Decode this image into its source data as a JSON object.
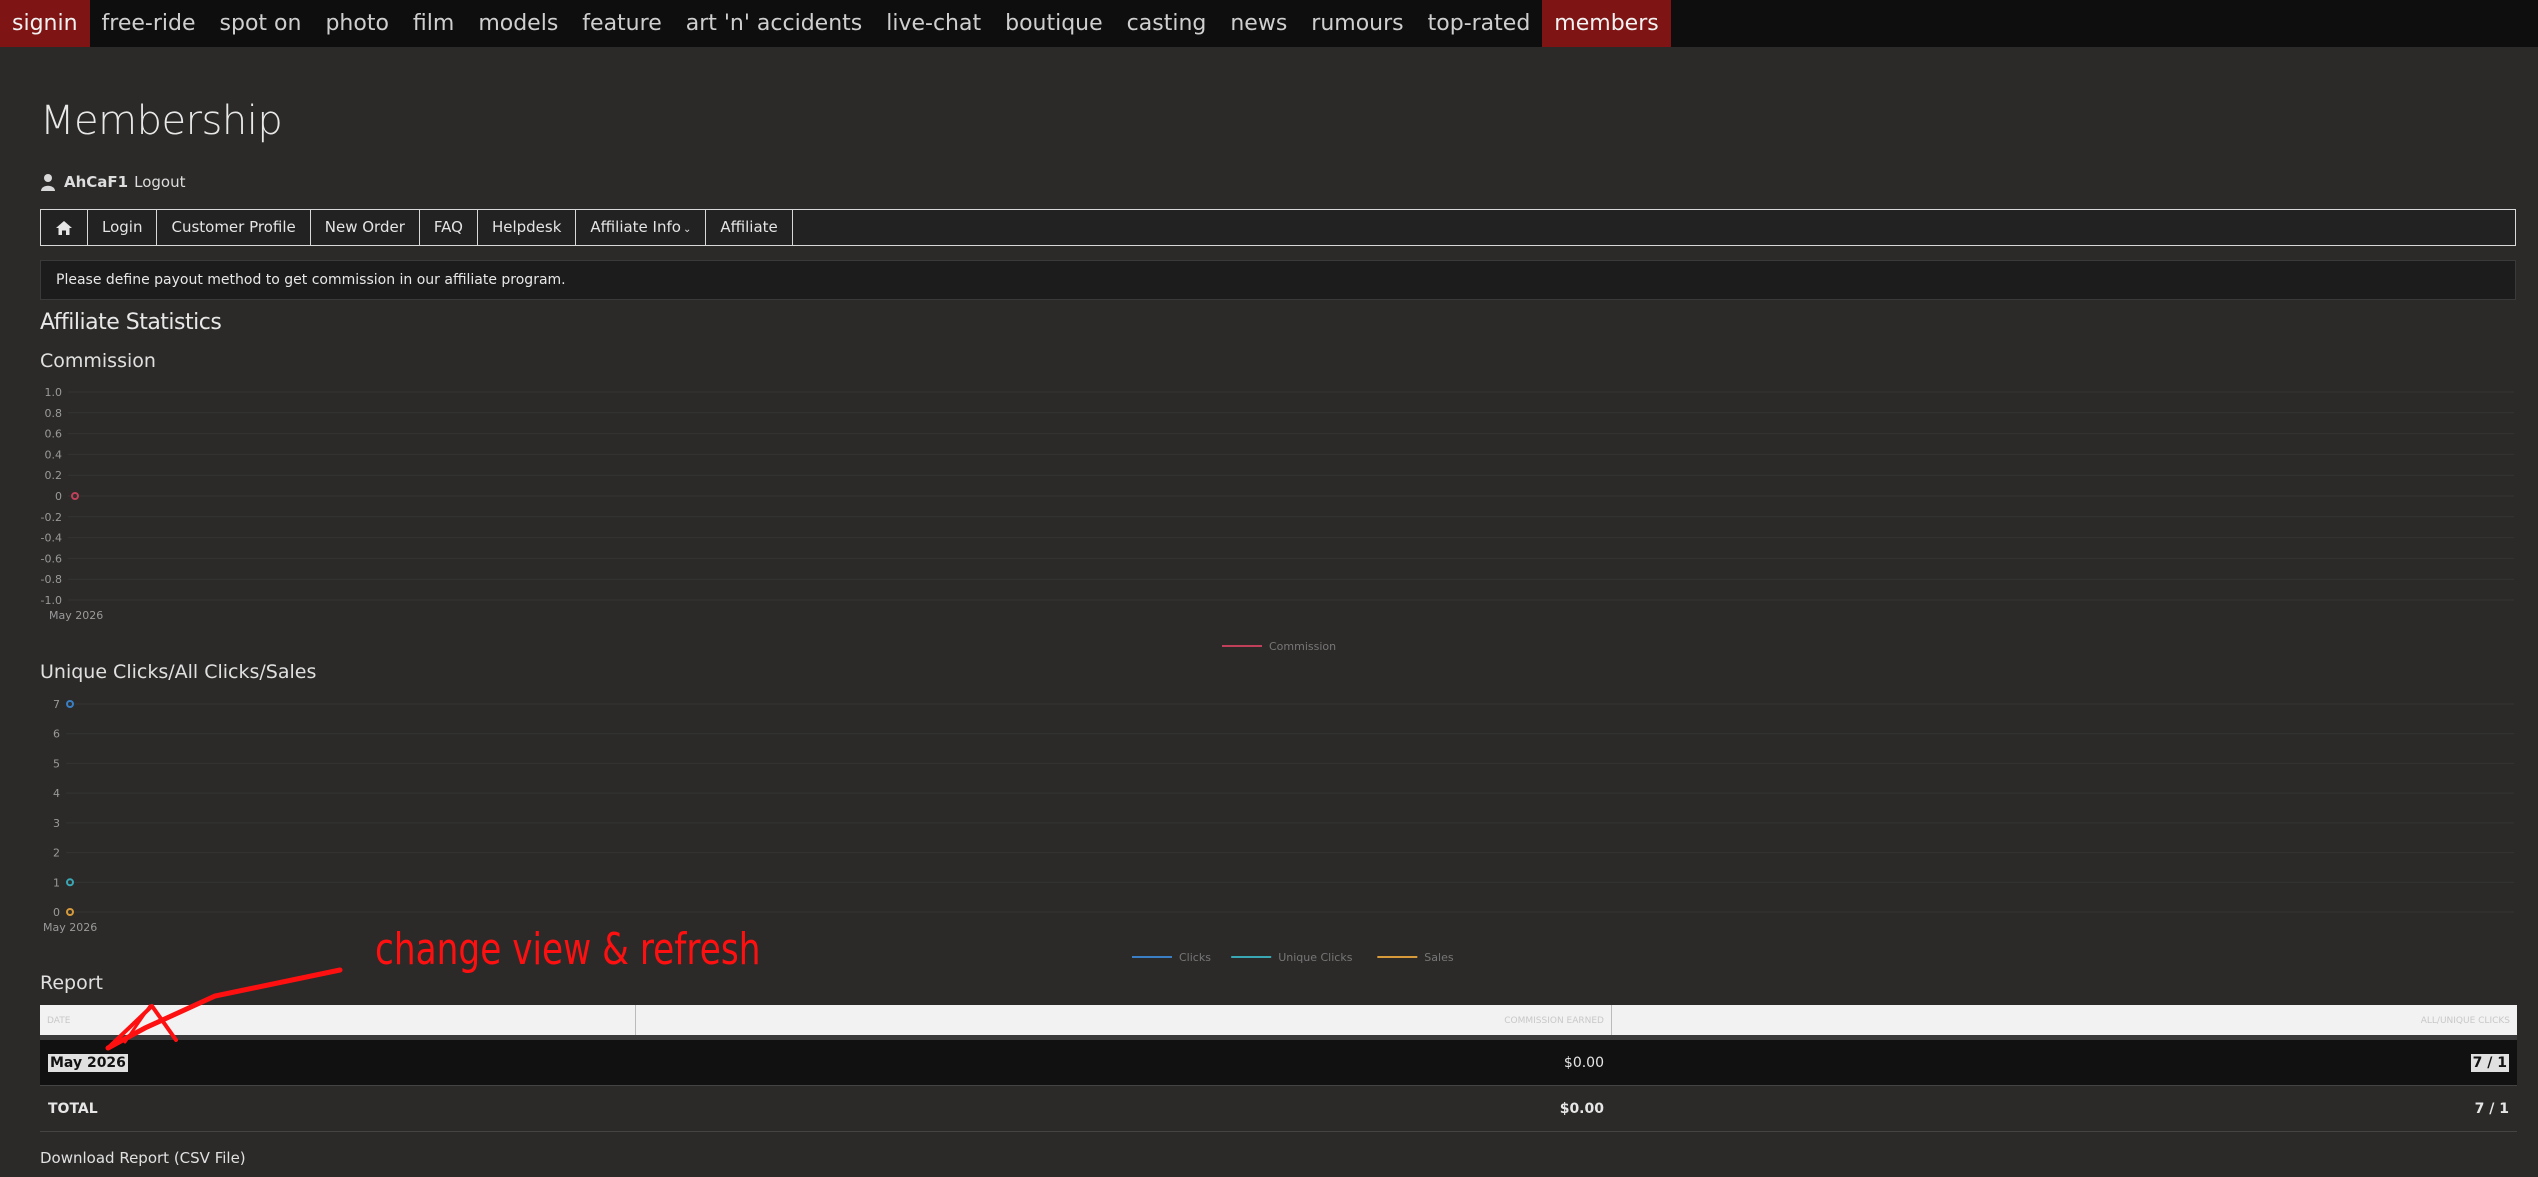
{
  "topnav": {
    "items": [
      "signin",
      "free-ride",
      "spot on",
      "photo",
      "film",
      "models",
      "feature",
      "art 'n' accidents",
      "live-chat",
      "boutique",
      "casting",
      "news",
      "rumours",
      "top-rated",
      "members"
    ]
  },
  "page": {
    "title": "Membership"
  },
  "user": {
    "name": "AhCaF1",
    "logout": "Logout"
  },
  "subnav": {
    "home_icon": "home-icon",
    "items": [
      "Login",
      "Customer Profile",
      "New Order",
      "FAQ",
      "Helpdesk",
      "Affiliate Info",
      "Affiliate"
    ]
  },
  "notice": "Please define payout method to get commission in our affiliate program.",
  "section_title": "Affiliate Statistics",
  "colors": {
    "commission": "#c0405a",
    "clicks": "#3a7fc4",
    "unique_clicks": "#3aa7b4",
    "sales": "#d69a3a",
    "annotation": "#ff1010"
  },
  "chart_data": [
    {
      "type": "line",
      "title": "Commission",
      "x": [
        "May 2026"
      ],
      "series": [
        {
          "name": "Commission",
          "values": [
            0
          ]
        }
      ],
      "yticks": [
        "1.0",
        "0.8",
        "0.6",
        "0.4",
        "0.2",
        "0",
        "-0.2",
        "-0.4",
        "-0.6",
        "-0.8",
        "-1.0"
      ],
      "ylim": [
        -1,
        1
      ],
      "legend": "bottom-center"
    },
    {
      "type": "line",
      "title": "Unique Clicks/All Clicks/Sales",
      "x": [
        "May 2026"
      ],
      "series": [
        {
          "name": "Clicks",
          "values": [
            7
          ]
        },
        {
          "name": "Unique Clicks",
          "values": [
            1
          ]
        },
        {
          "name": "Sales",
          "values": [
            0
          ]
        }
      ],
      "yticks": [
        "7",
        "6",
        "5",
        "4",
        "3",
        "2",
        "1",
        "0"
      ],
      "ylim": [
        0,
        7
      ],
      "legend": "bottom-center"
    }
  ],
  "report": {
    "title": "Report",
    "headers": [
      "DATE",
      "COMMISSION EARNED",
      "ALL/UNIQUE CLICKS"
    ],
    "row": {
      "date": "May 2026",
      "commission": "$0.00",
      "clicks": "7 / 1"
    },
    "total": {
      "label": "TOTAL",
      "commission": "$0.00",
      "clicks": "7 / 1"
    }
  },
  "download_label": "Download Report (CSV File)",
  "annotation": "change view & refresh"
}
